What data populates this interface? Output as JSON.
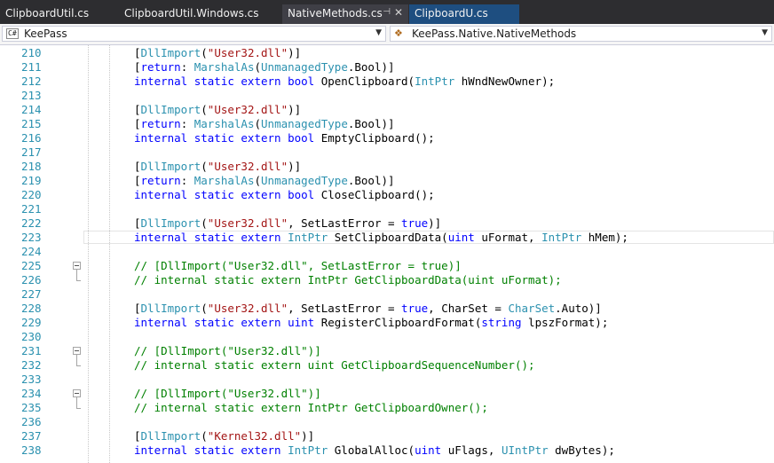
{
  "tabs": [
    {
      "label": "ClipboardUtil.cs",
      "state": "normal"
    },
    {
      "label": "ClipboardUtil.Windows.cs",
      "state": "normal"
    },
    {
      "label": "NativeMethods.cs",
      "state": "active"
    },
    {
      "label": "ClipboardU.cs",
      "state": "preview"
    }
  ],
  "nav": {
    "project": {
      "icon": "csharp-project-icon",
      "label": "KeePass"
    },
    "type": {
      "icon": "class-icon",
      "label": "KeePass.Native.NativeMethods"
    }
  },
  "colors": {
    "keyword": "#0000ff",
    "type": "#2b91af",
    "string": "#a31515",
    "comment": "#008000",
    "line_number": "#2b91af",
    "tab_bar": "#2d2d30",
    "preview_tab": "#1e4e80"
  },
  "lines": [
    {
      "n": "210",
      "tokens": [
        [
          "p",
          "["
        ],
        [
          "t",
          "DllImport"
        ],
        [
          "p",
          "("
        ],
        [
          "s",
          "\"User32.dll\""
        ],
        [
          "p",
          ")]"
        ]
      ]
    },
    {
      "n": "211",
      "tokens": [
        [
          "p",
          "["
        ],
        [
          "k",
          "return"
        ],
        [
          "p",
          ": "
        ],
        [
          "t",
          "MarshalAs"
        ],
        [
          "p",
          "("
        ],
        [
          "t",
          "UnmanagedType"
        ],
        [
          "p",
          ".Bool)]"
        ]
      ]
    },
    {
      "n": "212",
      "tokens": [
        [
          "k",
          "internal static extern bool"
        ],
        [
          "p",
          " OpenClipboard("
        ],
        [
          "t",
          "IntPtr"
        ],
        [
          "p",
          " hWndNewOwner);"
        ]
      ]
    },
    {
      "n": "213",
      "tokens": []
    },
    {
      "n": "214",
      "tokens": [
        [
          "p",
          "["
        ],
        [
          "t",
          "DllImport"
        ],
        [
          "p",
          "("
        ],
        [
          "s",
          "\"User32.dll\""
        ],
        [
          "p",
          ")]"
        ]
      ]
    },
    {
      "n": "215",
      "tokens": [
        [
          "p",
          "["
        ],
        [
          "k",
          "return"
        ],
        [
          "p",
          ": "
        ],
        [
          "t",
          "MarshalAs"
        ],
        [
          "p",
          "("
        ],
        [
          "t",
          "UnmanagedType"
        ],
        [
          "p",
          ".Bool)]"
        ]
      ]
    },
    {
      "n": "216",
      "tokens": [
        [
          "k",
          "internal static extern bool"
        ],
        [
          "p",
          " EmptyClipboard();"
        ]
      ]
    },
    {
      "n": "217",
      "tokens": []
    },
    {
      "n": "218",
      "tokens": [
        [
          "p",
          "["
        ],
        [
          "t",
          "DllImport"
        ],
        [
          "p",
          "("
        ],
        [
          "s",
          "\"User32.dll\""
        ],
        [
          "p",
          ")]"
        ]
      ]
    },
    {
      "n": "219",
      "tokens": [
        [
          "p",
          "["
        ],
        [
          "k",
          "return"
        ],
        [
          "p",
          ": "
        ],
        [
          "t",
          "MarshalAs"
        ],
        [
          "p",
          "("
        ],
        [
          "t",
          "UnmanagedType"
        ],
        [
          "p",
          ".Bool)]"
        ]
      ]
    },
    {
      "n": "220",
      "tokens": [
        [
          "k",
          "internal static extern bool"
        ],
        [
          "p",
          " CloseClipboard();"
        ]
      ]
    },
    {
      "n": "221",
      "tokens": []
    },
    {
      "n": "222",
      "tokens": [
        [
          "p",
          "["
        ],
        [
          "t",
          "DllImport"
        ],
        [
          "p",
          "("
        ],
        [
          "s",
          "\"User32.dll\""
        ],
        [
          "p",
          ", SetLastError = "
        ],
        [
          "k",
          "true"
        ],
        [
          "p",
          ")]"
        ]
      ]
    },
    {
      "n": "223",
      "tokens": [
        [
          "k",
          "internal static extern "
        ],
        [
          "t",
          "IntPtr"
        ],
        [
          "p",
          " SetClipboardData("
        ],
        [
          "k",
          "uint"
        ],
        [
          "p",
          " uFormat, "
        ],
        [
          "t",
          "IntPtr"
        ],
        [
          "p",
          " hMem);"
        ]
      ],
      "current": true
    },
    {
      "n": "224",
      "tokens": []
    },
    {
      "n": "225",
      "tokens": [
        [
          "c",
          "// [DllImport(\"User32.dll\", SetLastError = true)]"
        ]
      ],
      "fold": "start"
    },
    {
      "n": "226",
      "tokens": [
        [
          "c",
          "// internal static extern IntPtr GetClipboardData(uint uFormat);"
        ]
      ],
      "fold": "end"
    },
    {
      "n": "227",
      "tokens": []
    },
    {
      "n": "228",
      "tokens": [
        [
          "p",
          "["
        ],
        [
          "t",
          "DllImport"
        ],
        [
          "p",
          "("
        ],
        [
          "s",
          "\"User32.dll\""
        ],
        [
          "p",
          ", SetLastError = "
        ],
        [
          "k",
          "true"
        ],
        [
          "p",
          ", CharSet = "
        ],
        [
          "t",
          "CharSet"
        ],
        [
          "p",
          ".Auto)]"
        ]
      ]
    },
    {
      "n": "229",
      "tokens": [
        [
          "k",
          "internal static extern uint"
        ],
        [
          "p",
          " RegisterClipboardFormat("
        ],
        [
          "k",
          "string"
        ],
        [
          "p",
          " lpszFormat);"
        ]
      ]
    },
    {
      "n": "230",
      "tokens": []
    },
    {
      "n": "231",
      "tokens": [
        [
          "c",
          "// [DllImport(\"User32.dll\")]"
        ]
      ],
      "fold": "start"
    },
    {
      "n": "232",
      "tokens": [
        [
          "c",
          "// internal static extern uint GetClipboardSequenceNumber();"
        ]
      ],
      "fold": "end"
    },
    {
      "n": "233",
      "tokens": []
    },
    {
      "n": "234",
      "tokens": [
        [
          "c",
          "// [DllImport(\"User32.dll\")]"
        ]
      ],
      "fold": "start"
    },
    {
      "n": "235",
      "tokens": [
        [
          "c",
          "// internal static extern IntPtr GetClipboardOwner();"
        ]
      ],
      "fold": "end"
    },
    {
      "n": "236",
      "tokens": []
    },
    {
      "n": "237",
      "tokens": [
        [
          "p",
          "["
        ],
        [
          "t",
          "DllImport"
        ],
        [
          "p",
          "("
        ],
        [
          "s",
          "\"Kernel32.dll\""
        ],
        [
          "p",
          ")]"
        ]
      ]
    },
    {
      "n": "238",
      "tokens": [
        [
          "k",
          "internal static extern "
        ],
        [
          "t",
          "IntPtr"
        ],
        [
          "p",
          " GlobalAlloc("
        ],
        [
          "k",
          "uint"
        ],
        [
          "p",
          " uFlags, "
        ],
        [
          "t",
          "UIntPtr"
        ],
        [
          "p",
          " dwBytes);"
        ]
      ]
    }
  ]
}
